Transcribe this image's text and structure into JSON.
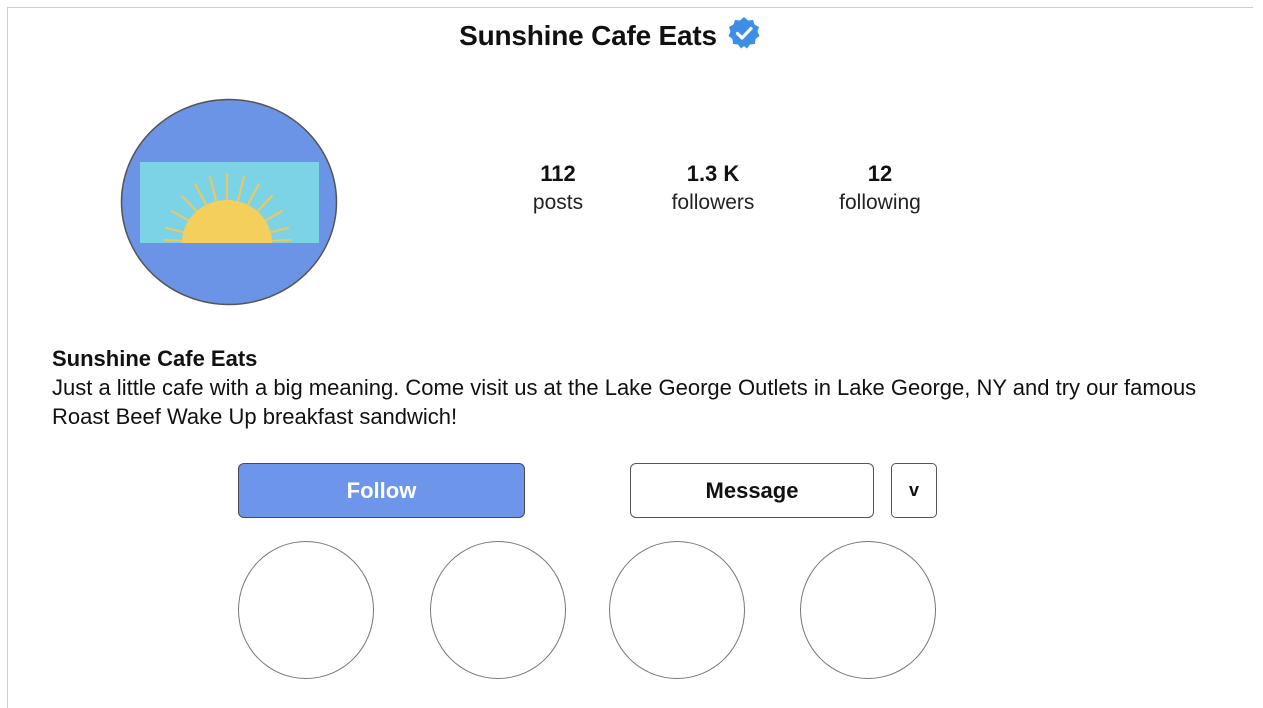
{
  "header": {
    "title": "Sunshine Cafe Eats",
    "verified_icon": "verified-badge-icon",
    "verified_color": "#3d8ee6"
  },
  "profile": {
    "avatar_icon": "sunrise-logo-icon",
    "colors": {
      "avatar_bg": "#6b93e6",
      "sky": "#7dd3e6",
      "sun": "#f5cf5c"
    }
  },
  "stats": {
    "posts": {
      "value": "112",
      "label": "posts"
    },
    "followers": {
      "value": "1.3 K",
      "label": "followers"
    },
    "following": {
      "value": "12",
      "label": "following"
    }
  },
  "bio": {
    "name": "Sunshine Cafe Eats",
    "text": "Just a little cafe with a big meaning. Come visit us at the Lake George Outlets in Lake George, NY and try our famous Roast Beef Wake Up breakfast sandwich!"
  },
  "actions": {
    "follow_label": "Follow",
    "message_label": "Message",
    "dropdown_label": "v",
    "follow_color": "#6d96ea"
  },
  "highlights": [
    {
      "name": "highlight-1"
    },
    {
      "name": "highlight-2"
    },
    {
      "name": "highlight-3"
    },
    {
      "name": "highlight-4"
    }
  ]
}
